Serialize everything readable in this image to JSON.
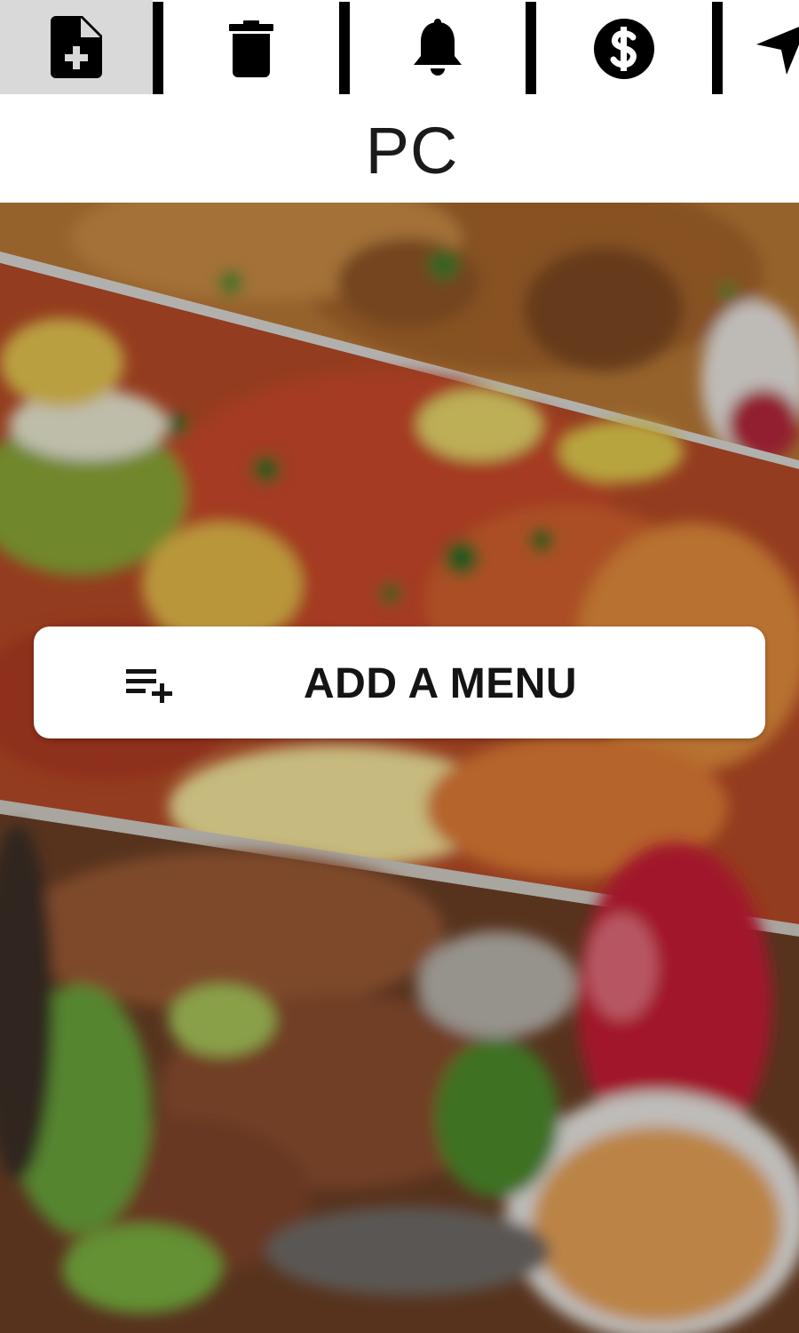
{
  "toolbar": {
    "items": [
      {
        "icon": "new-document-icon",
        "active": true
      },
      {
        "icon": "trash-icon",
        "active": false
      },
      {
        "icon": "bell-icon",
        "active": false
      },
      {
        "icon": "dollar-icon",
        "active": false
      },
      {
        "icon": "navigation-arrow-icon",
        "active": false
      }
    ],
    "active_background": "#d9d9d9"
  },
  "header": {
    "title": "PC"
  },
  "main": {
    "background_image": "food-collage",
    "add_menu_button": {
      "label": "ADD A MENU",
      "icon": "playlist-add-icon"
    }
  },
  "colors": {
    "icon": "#000000",
    "button_background": "#ffffff",
    "button_text": "#141414"
  }
}
